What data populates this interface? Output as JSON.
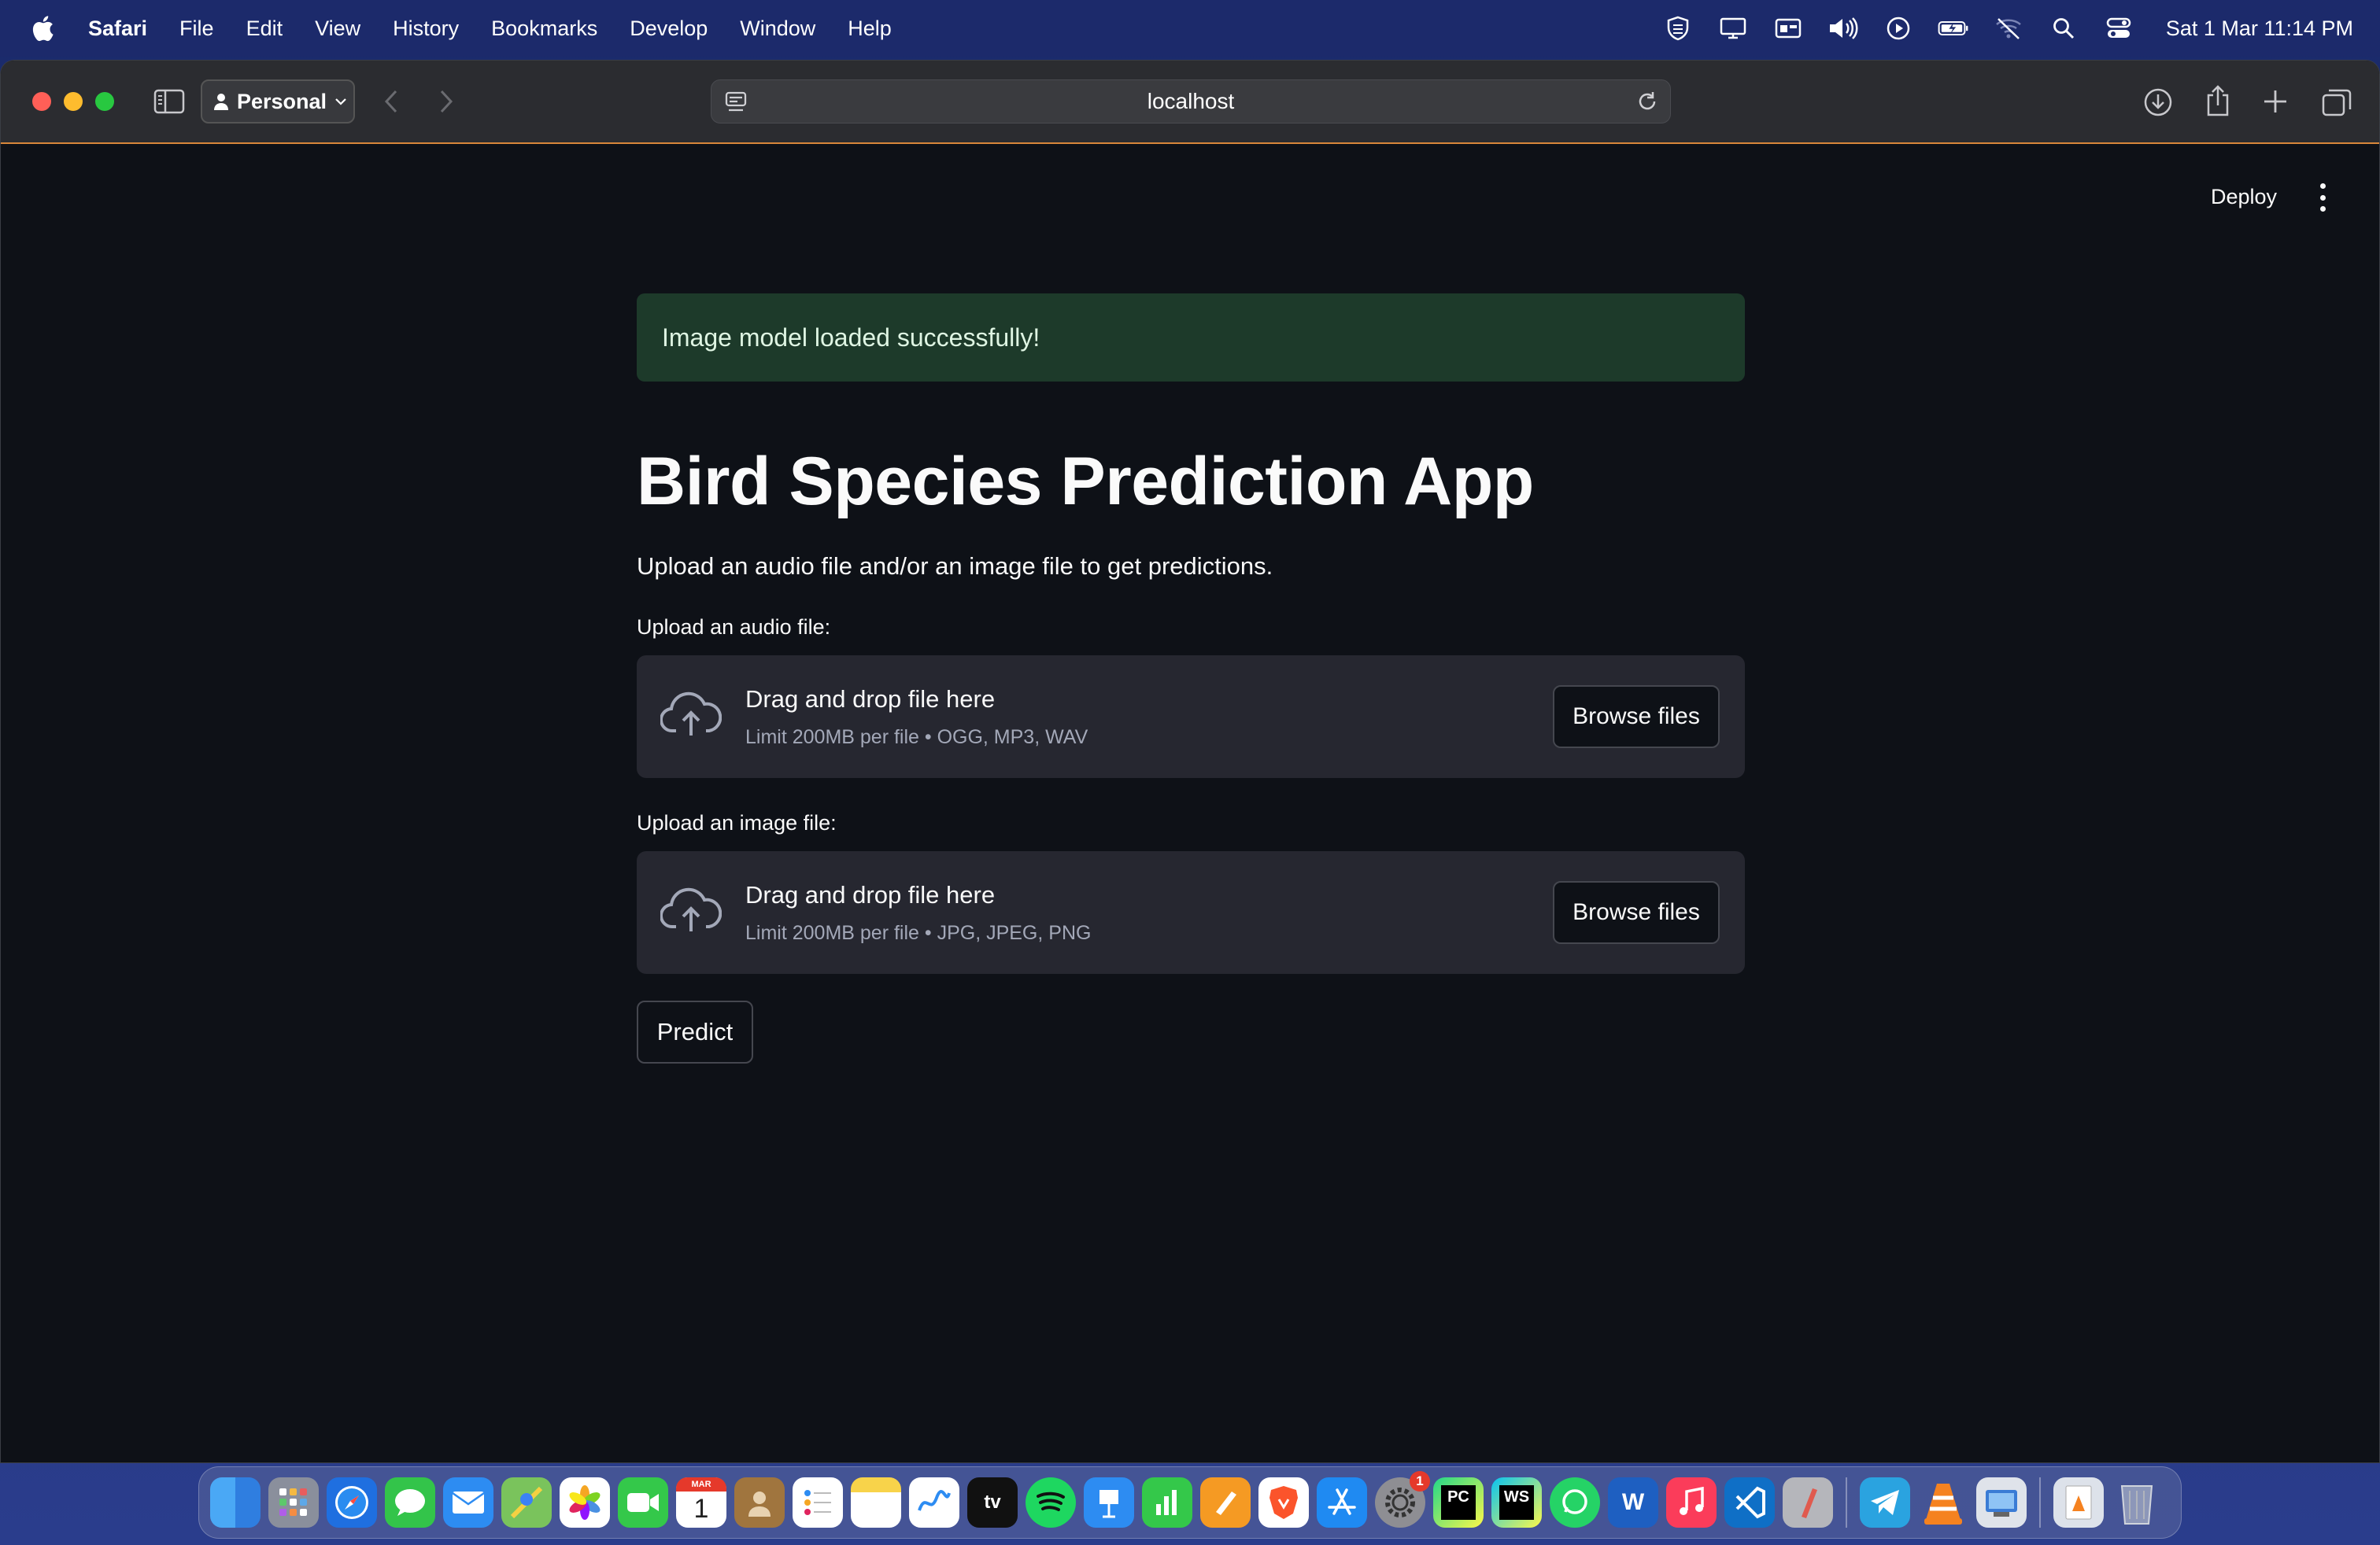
{
  "menubar": {
    "app_name": "Safari",
    "items": [
      "File",
      "Edit",
      "View",
      "History",
      "Bookmarks",
      "Develop",
      "Window",
      "Help"
    ],
    "clock": "Sat 1 Mar  11:14 PM"
  },
  "browser": {
    "profile": "Personal",
    "url": "localhost"
  },
  "app": {
    "deploy_label": "Deploy",
    "alert": "Image model loaded successfully!",
    "title": "Bird Species Prediction App",
    "subtitle": "Upload an audio file and/or an image file to get predictions.",
    "audio_uploader": {
      "label": "Upload an audio file:",
      "drop_text": "Drag and drop file here",
      "limit": "Limit 200MB per file • OGG, MP3, WAV",
      "button": "Browse files"
    },
    "image_uploader": {
      "label": "Upload an image file:",
      "drop_text": "Drag and drop file here",
      "limit": "Limit 200MB per file • JPG, JPEG, PNG",
      "button": "Browse files"
    },
    "predict_label": "Predict"
  },
  "dock": {
    "calendar_month": "MAR",
    "calendar_day": "1",
    "tv_label": "tv",
    "pycharm_label": "PC",
    "webstorm_label": "WS",
    "word_label": "W",
    "settings_badge": "1"
  },
  "colors": {
    "accent_success_bg": "#1d3a2a",
    "app_bg": "#0e1117",
    "dropzone_bg": "#262730"
  }
}
